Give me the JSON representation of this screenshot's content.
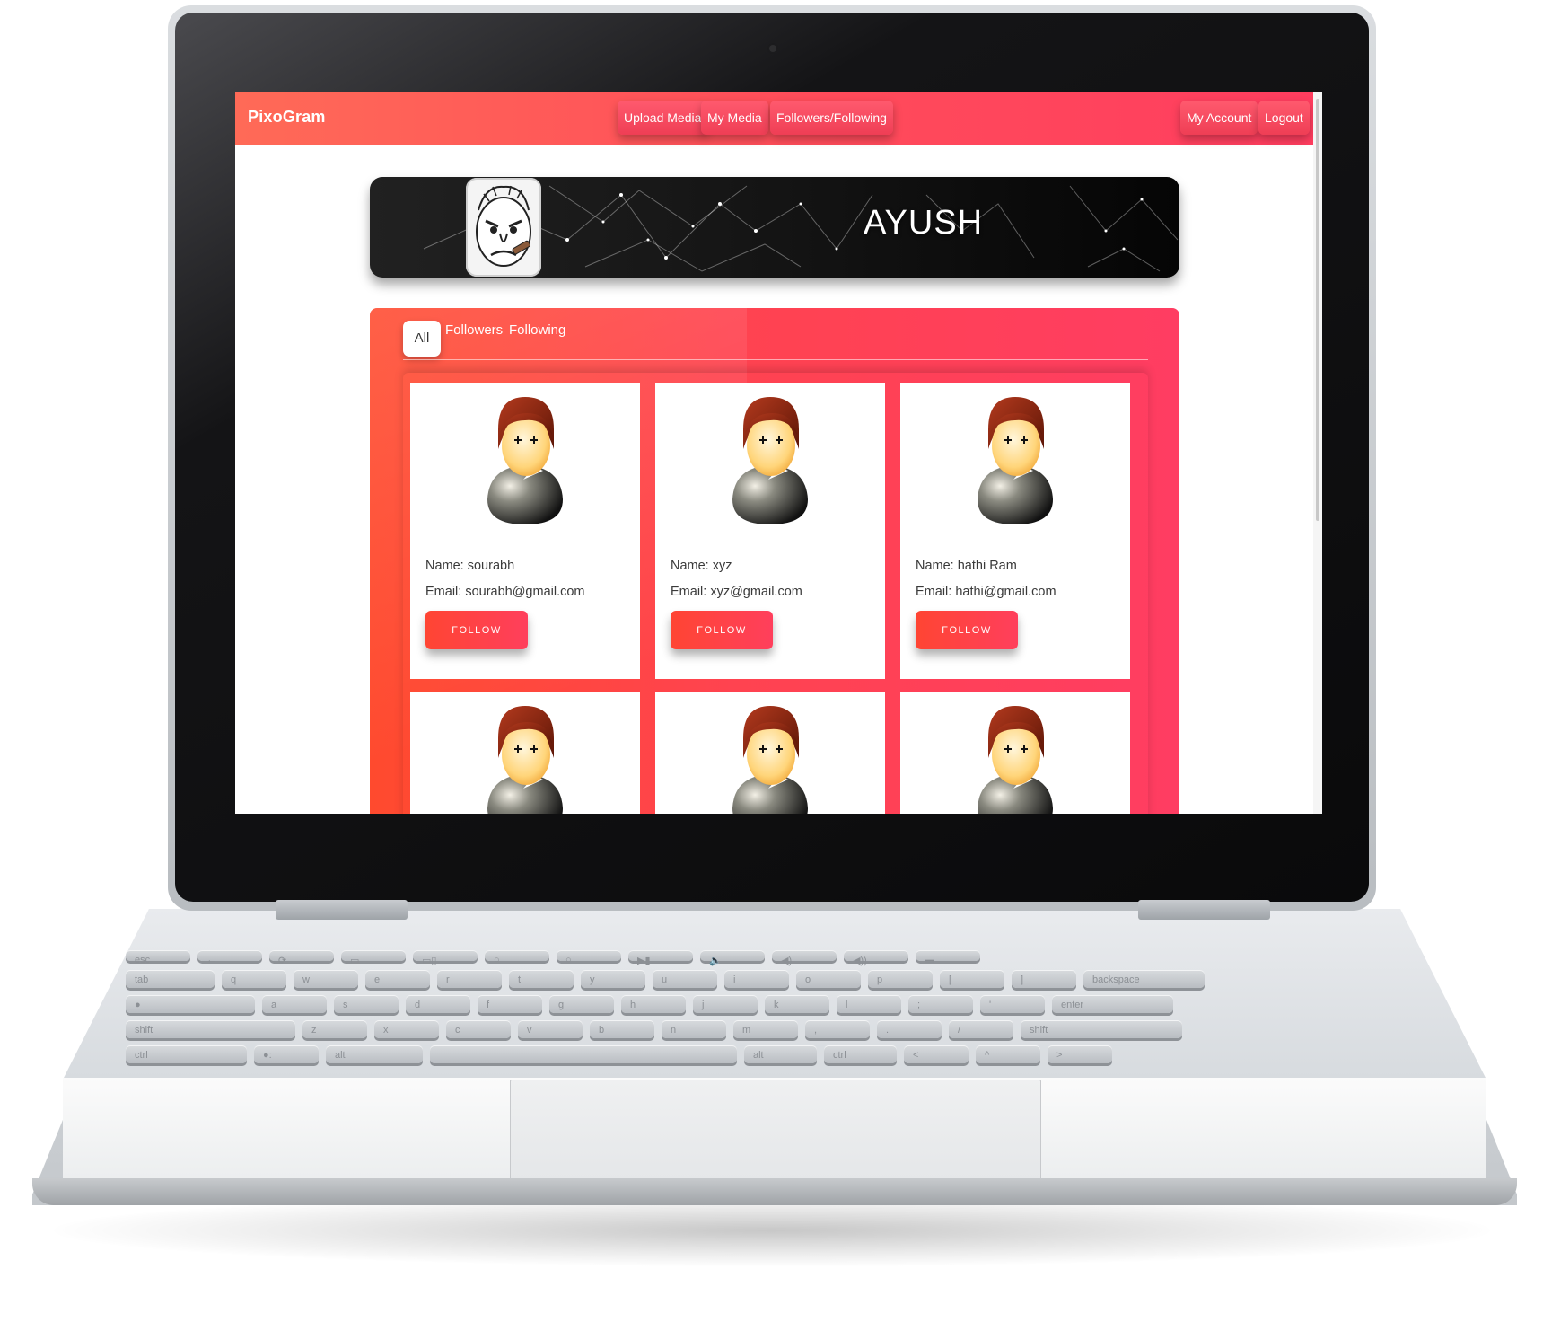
{
  "app": {
    "brand": "PixoGram",
    "nav_center": [
      "Upload Media",
      "My Media",
      "Followers/Following"
    ],
    "nav_right": [
      "My Account",
      "Logout"
    ],
    "accent_color": "#ff4b5a"
  },
  "profile": {
    "name": "AYUSH"
  },
  "tabs": [
    {
      "label": "All",
      "active": true
    },
    {
      "label": "Followers",
      "active": false
    },
    {
      "label": "Following",
      "active": false
    }
  ],
  "users": [
    {
      "name": "Name: sourabh",
      "email": "Email: sourabh@gmail.com",
      "button": "FOLLOW"
    },
    {
      "name": "Name: xyz",
      "email": "Email: xyz@gmail.com",
      "button": "FOLLOW"
    },
    {
      "name": "Name: hathi Ram",
      "email": "Email: hathi@gmail.com",
      "button": "FOLLOW"
    }
  ],
  "keyboard": {
    "row1": [
      "esc",
      "←",
      "⟳",
      "▭",
      "▭▯",
      "○",
      "○",
      "▶▮",
      "🔈",
      "◀)",
      "◀))",
      "▬"
    ],
    "row2": [
      "tab",
      "q",
      "w",
      "e",
      "r",
      "t",
      "y",
      "u",
      "i",
      "o",
      "p",
      "[",
      "]",
      "backspace"
    ],
    "row3": [
      "●",
      "a",
      "s",
      "d",
      "f",
      "g",
      "h",
      "j",
      "k",
      "l",
      ";",
      "'",
      "enter"
    ],
    "row4": [
      "shift",
      "z",
      "x",
      "c",
      "v",
      "b",
      "n",
      "m",
      ",",
      ".",
      "/",
      "shift"
    ],
    "row5": [
      "ctrl",
      "●:",
      "alt",
      "",
      "alt",
      "ctrl",
      "<",
      "^",
      ">"
    ]
  }
}
